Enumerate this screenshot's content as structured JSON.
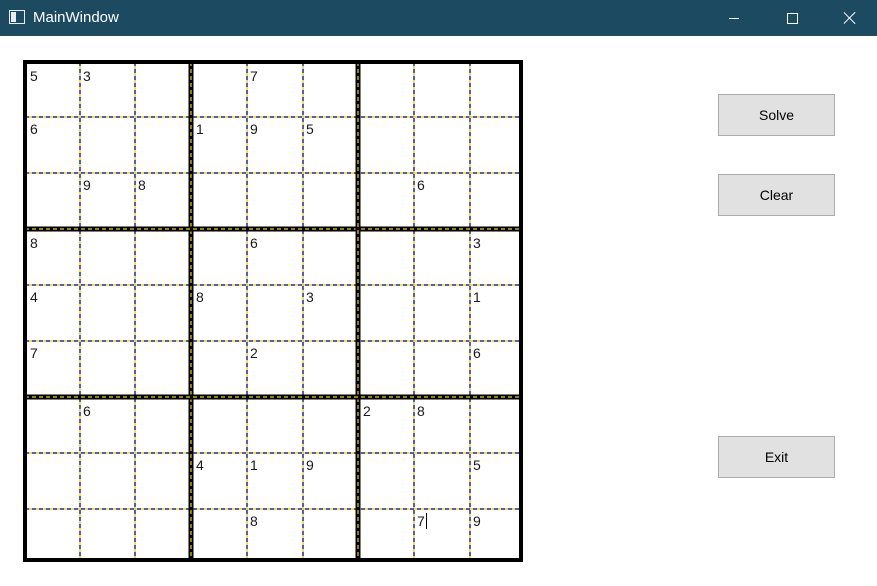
{
  "window": {
    "title": "MainWindow",
    "controls": [
      "minimize-icon",
      "maximize-icon",
      "close-icon"
    ]
  },
  "sudoku": {
    "rows": [
      [
        "5",
        "3",
        "",
        "",
        "7",
        "",
        "",
        "",
        ""
      ],
      [
        "6",
        "",
        "",
        "1",
        "9",
        "5",
        "",
        "",
        ""
      ],
      [
        "",
        "9",
        "8",
        "",
        "",
        "",
        "",
        "6",
        ""
      ],
      [
        "8",
        "",
        "",
        "",
        "6",
        "",
        "",
        "",
        "3"
      ],
      [
        "4",
        "",
        "",
        "8",
        "",
        "3",
        "",
        "",
        "1"
      ],
      [
        "7",
        "",
        "",
        "",
        "2",
        "",
        "",
        "",
        "6"
      ],
      [
        "",
        "6",
        "",
        "",
        "",
        "",
        "2",
        "8",
        ""
      ],
      [
        "",
        "",
        "",
        "4",
        "1",
        "9",
        "",
        "",
        "5"
      ],
      [
        "",
        "",
        "",
        "",
        "8",
        "",
        "",
        "7",
        "9"
      ]
    ],
    "caret_cell": [
      8,
      7
    ]
  },
  "buttons": {
    "solve": "Solve",
    "clear": "Clear",
    "exit": "Exit"
  },
  "colors": {
    "titlebar": "#1c4a60",
    "thin_grid_a": "#1f2fd6",
    "thin_grid_b": "#f2d500",
    "thick_grid": "#000000",
    "button_bg": "#e1e1e1"
  }
}
